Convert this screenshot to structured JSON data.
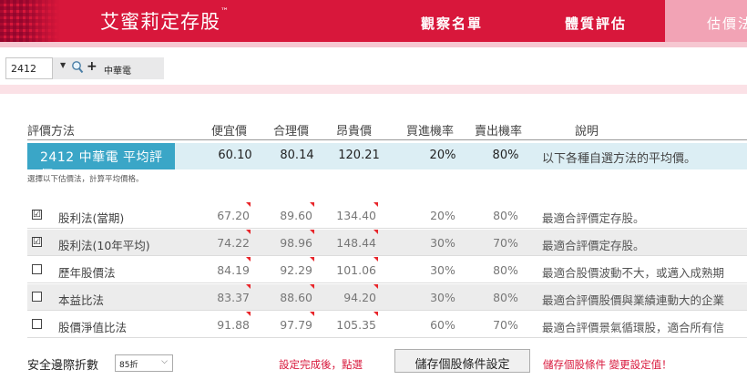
{
  "header": {
    "brand": "艾蜜莉定存股",
    "brand_tm": "™",
    "nav": {
      "watchlist": "觀察名單",
      "quality": "體質評估",
      "valuation": "估價法"
    }
  },
  "selector": {
    "stock_code": "2412",
    "stock_name": "中華電",
    "plus": "+"
  },
  "table": {
    "headers": {
      "method": "評價方法",
      "cheap": "便宜價",
      "fair": "合理價",
      "expensive": "昂貴價",
      "buy_prob": "買進機率",
      "sell_prob": "賣出機率",
      "desc": "說明"
    },
    "average": {
      "title": "2412 中華電  平均評價",
      "cheap": "60.10",
      "fair": "80.14",
      "expensive": "120.21",
      "buy_prob": "20%",
      "sell_prob": "80%",
      "desc": "以下各種自選方法的平均價。",
      "hint": "選擇以下估價法，計算平均價格。"
    },
    "rows": [
      {
        "checked": "☑",
        "name": "股利法(當期)",
        "cheap": "67.20",
        "fair": "89.60",
        "expensive": "134.40",
        "buy_prob": "20%",
        "sell_prob": "80%",
        "desc": "最適合評價定存股。"
      },
      {
        "checked": "☑",
        "name": "股利法(10年平均)",
        "cheap": "74.22",
        "fair": "98.96",
        "expensive": "148.44",
        "buy_prob": "30%",
        "sell_prob": "70%",
        "desc": "最適合評價定存股。"
      },
      {
        "checked": "",
        "name": "歷年股價法",
        "cheap": "84.19",
        "fair": "92.29",
        "expensive": "101.06",
        "buy_prob": "30%",
        "sell_prob": "80%",
        "desc": "最適合股價波動不大，或邁入成熟期"
      },
      {
        "checked": "",
        "name": "本益比法",
        "cheap": "83.37",
        "fair": "88.60",
        "expensive": "94.20",
        "buy_prob": "30%",
        "sell_prob": "80%",
        "desc": "最適合評價股價與業績連動大的企業"
      },
      {
        "checked": "",
        "name": "股價淨值比法",
        "cheap": "91.88",
        "fair": "97.79",
        "expensive": "105.35",
        "buy_prob": "60%",
        "sell_prob": "70%",
        "desc": "最適合評價景氣循環股，適合所有信"
      }
    ]
  },
  "footer": {
    "margin_label": "安全邊際折數",
    "margin_value": "85折",
    "hint": "設定完成後，點選",
    "save_button": "儲存個股條件設定",
    "save_note": "儲存個股條件 變更設定值！"
  },
  "colors": {
    "header": "#d8173b",
    "avg_title": "#3aa6c7",
    "avg_row": "#dceef4",
    "flag": "#e8262b"
  }
}
